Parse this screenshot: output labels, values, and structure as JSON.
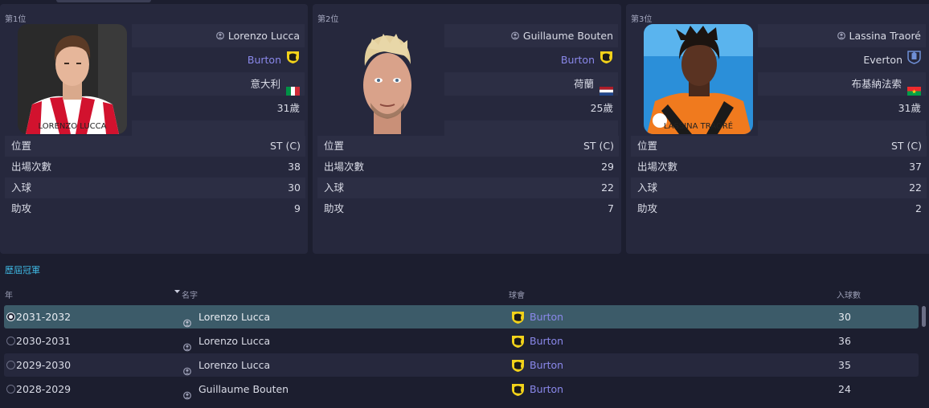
{
  "leaders": [
    {
      "rank": "第1位",
      "name": "Lorenzo Lucca",
      "club": "Burton",
      "club_link": true,
      "nationality": "意大利",
      "flag": "italy",
      "age": "31歲",
      "shirt_text": "LORENZO LUCCA",
      "stats": [
        {
          "label": "位置",
          "value": "ST (C)"
        },
        {
          "label": "出場次數",
          "value": "38"
        },
        {
          "label": "入球",
          "value": "30"
        },
        {
          "label": "助攻",
          "value": "9"
        }
      ]
    },
    {
      "rank": "第2位",
      "name": "Guillaume Bouten",
      "club": "Burton",
      "club_link": true,
      "nationality": "荷蘭",
      "flag": "netherlands",
      "age": "25歲",
      "shirt_text": "",
      "stats": [
        {
          "label": "位置",
          "value": "ST (C)"
        },
        {
          "label": "出場次數",
          "value": "29"
        },
        {
          "label": "入球",
          "value": "22"
        },
        {
          "label": "助攻",
          "value": "7"
        }
      ]
    },
    {
      "rank": "第3位",
      "name": "Lassina Traoré",
      "club": "Everton",
      "club_link": false,
      "nationality": "布基納法索",
      "flag": "burkina-faso",
      "age": "31歲",
      "shirt_text": "LASSINA TRAORÉ",
      "stats": [
        {
          "label": "位置",
          "value": "ST (C)"
        },
        {
          "label": "出場次數",
          "value": "37"
        },
        {
          "label": "入球",
          "value": "22"
        },
        {
          "label": "助攻",
          "value": "2"
        }
      ]
    }
  ],
  "history": {
    "title": "歷屆冠軍",
    "columns": {
      "year": "年",
      "name": "名字",
      "club": "球會",
      "goals": "入球數"
    },
    "sort_column": "name",
    "rows": [
      {
        "year": "2031-2032",
        "name": "Lorenzo Lucca",
        "club": "Burton",
        "goals": "30",
        "selected": true
      },
      {
        "year": "2030-2031",
        "name": "Lorenzo Lucca",
        "club": "Burton",
        "goals": "36",
        "selected": false
      },
      {
        "year": "2029-2030",
        "name": "Lorenzo Lucca",
        "club": "Burton",
        "goals": "35",
        "selected": false
      },
      {
        "year": "2028-2029",
        "name": "Guillaume Bouten",
        "club": "Burton",
        "goals": "24",
        "selected": false
      }
    ]
  },
  "colors": {
    "background": "#1c1e2f",
    "card": "#26283d",
    "row_shade": "#2c2e44",
    "accent_link": "#8a88ea",
    "section_title": "#3fb8e3",
    "selected_row": "#3c5b69",
    "burton_crest": "#f2d21a"
  },
  "icons": [
    "person-icon",
    "burton-crest-icon",
    "everton-crest-icon",
    "sort-arrow-icon",
    "radio-icon"
  ]
}
